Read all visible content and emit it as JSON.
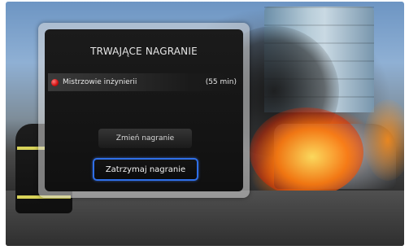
{
  "dialog": {
    "title": "TRWAJĄCE NAGRANIE",
    "recording": {
      "name": "Mistrzowie inżynierii",
      "duration": "(55 min)",
      "indicator_color": "#d01010"
    },
    "buttons": {
      "change_label": "Zmień nagranie",
      "stop_label": "Zatrzymaj nagranie"
    },
    "focus_color": "#2f6fe8"
  },
  "background": {
    "icons": [
      "fire-scene-image"
    ]
  }
}
